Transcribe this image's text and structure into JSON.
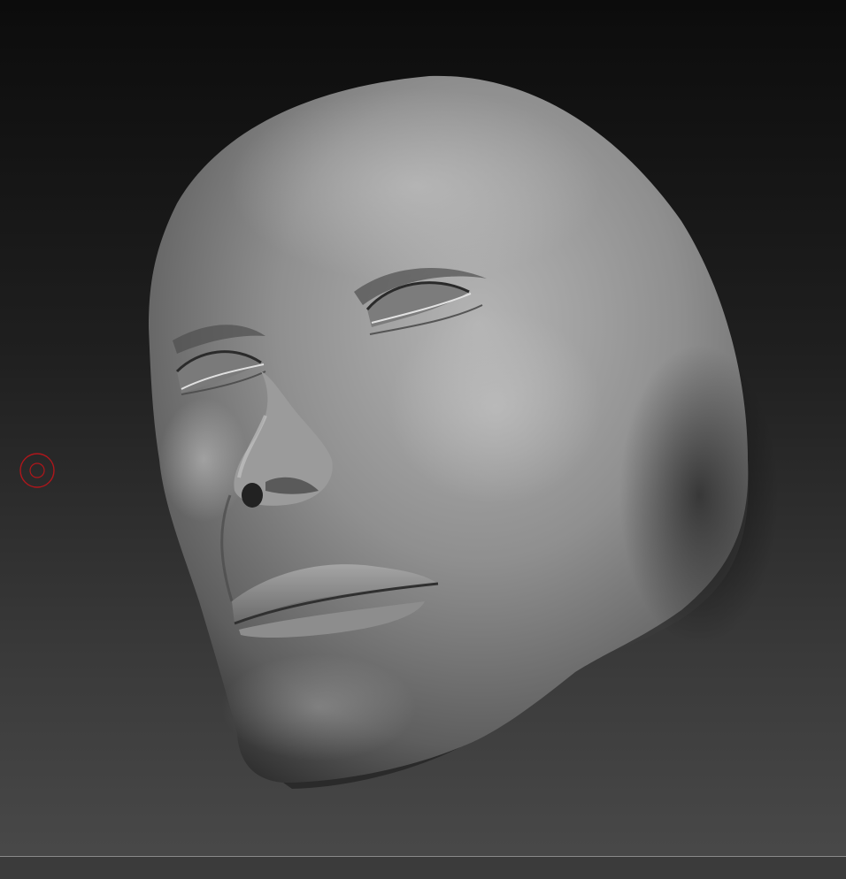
{
  "viewport": {
    "background_top": "#0c0c0c",
    "background_bottom": "#4a4a4a",
    "floor_line_color": "#8a8a8a"
  },
  "model": {
    "icon": "sculpted-head-mesh",
    "material_color": "#8c8c8c"
  },
  "brush_cursor": {
    "icon": "brush-circle-icon",
    "color": "#b0161b"
  }
}
